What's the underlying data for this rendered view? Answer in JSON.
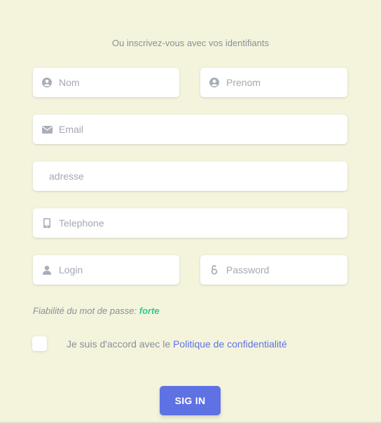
{
  "form": {
    "subtitle": "Ou inscrivez-vous avec vos identifiants",
    "fields": {
      "nom": {
        "placeholder": "Nom",
        "icon": "user-circle-icon"
      },
      "prenom": {
        "placeholder": "Prenom",
        "icon": "user-circle-icon"
      },
      "email": {
        "placeholder": "Email",
        "icon": "envelope-icon"
      },
      "adresse": {
        "placeholder": "adresse"
      },
      "telephone": {
        "placeholder": "Telephone",
        "icon": "mobile-phone-icon"
      },
      "login": {
        "placeholder": "Login",
        "icon": "user-icon"
      },
      "password": {
        "placeholder": "Password",
        "icon": "lock-icon"
      }
    },
    "password_strength": {
      "label": "Fiabilité du mot de passe:",
      "value": "forte",
      "color": "#2dce89"
    },
    "agreement": {
      "text": "Je suis d'accord avec le",
      "link": "Politique de confidentialité"
    },
    "submit_label": "SIG IN"
  },
  "colors": {
    "background": "#f4f4dc",
    "accent": "#5e72e4",
    "muted_text": "#8a8f99",
    "placeholder": "#a4a8b1"
  }
}
